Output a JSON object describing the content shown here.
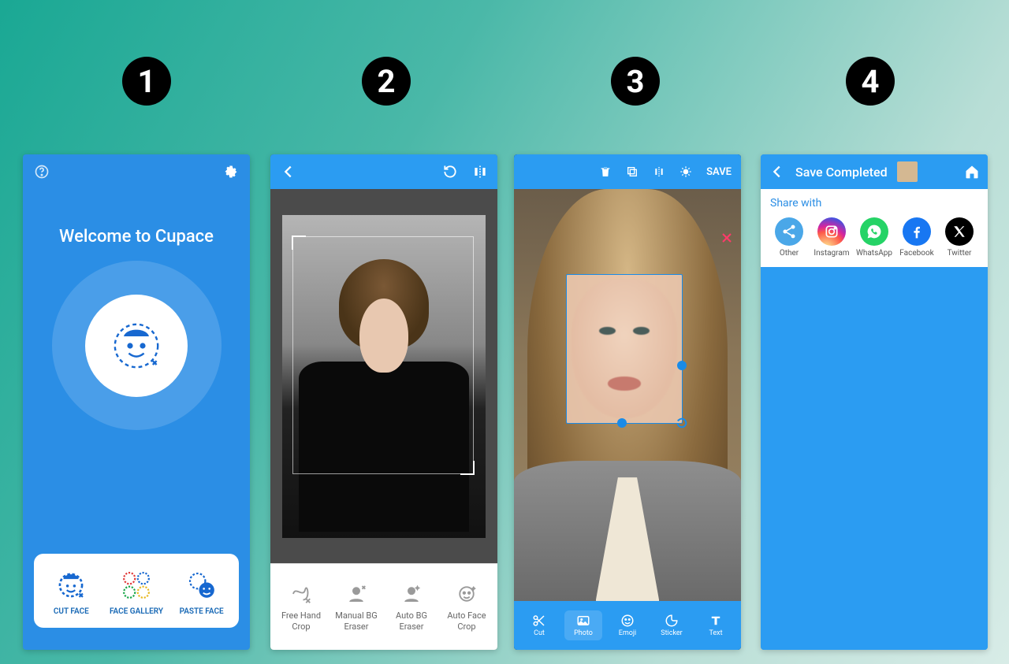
{
  "steps": [
    "1",
    "2",
    "3",
    "4"
  ],
  "screen1": {
    "welcome": "Welcome to Cupace",
    "actions": [
      {
        "label": "CUT FACE"
      },
      {
        "label": "FACE GALLERY"
      },
      {
        "label": "PASTE FACE"
      }
    ]
  },
  "screen2": {
    "tools": [
      {
        "label": "Free Hand Crop"
      },
      {
        "label": "Manual BG Eraser"
      },
      {
        "label": "Auto BG Eraser"
      },
      {
        "label": "Auto Face Crop"
      }
    ]
  },
  "screen3": {
    "save": "SAVE",
    "tabs": [
      {
        "label": "Cut"
      },
      {
        "label": "Photo"
      },
      {
        "label": "Emoji"
      },
      {
        "label": "Sticker"
      },
      {
        "label": "Text"
      }
    ]
  },
  "screen4": {
    "title": "Save Completed",
    "share_label": "Share with",
    "share": [
      {
        "label": "Other",
        "bg": "#4aa7e8",
        "fg": "#fff"
      },
      {
        "label": "Instagram",
        "bg": "#fff",
        "fg": "#e1306c"
      },
      {
        "label": "WhatsApp",
        "bg": "#25d366",
        "fg": "#fff"
      },
      {
        "label": "Facebook",
        "bg": "#1877f2",
        "fg": "#fff"
      },
      {
        "label": "Twitter",
        "bg": "#000",
        "fg": "#fff"
      }
    ]
  }
}
